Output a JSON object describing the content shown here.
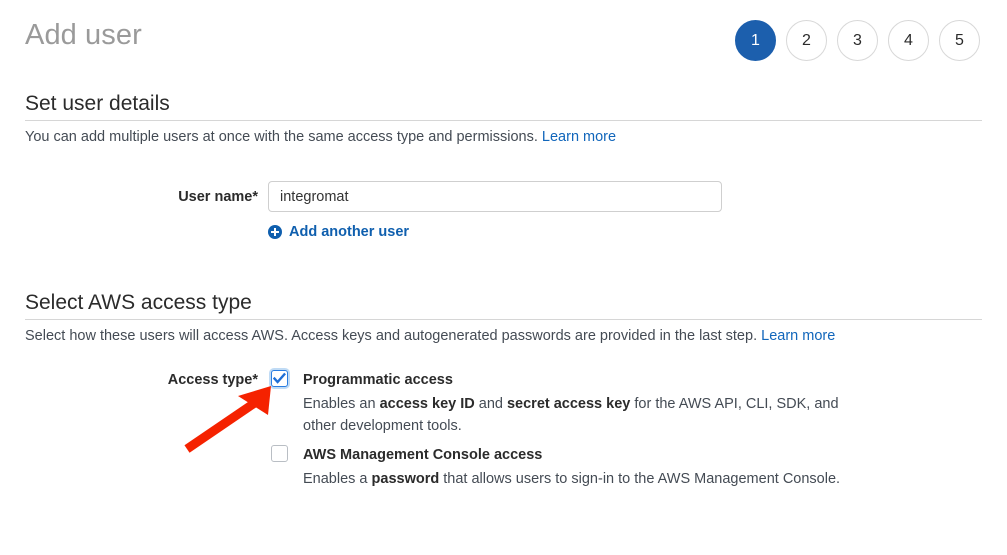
{
  "page": {
    "title": "Add user"
  },
  "wizard": {
    "steps": [
      {
        "label": "1",
        "state": "active"
      },
      {
        "label": "2",
        "state": "inactive"
      },
      {
        "label": "3",
        "state": "inactive"
      },
      {
        "label": "4",
        "state": "inactive"
      },
      {
        "label": "5",
        "state": "inactive"
      }
    ]
  },
  "user_details": {
    "heading": "Set user details",
    "description": "You can add multiple users at once with the same access type and permissions.",
    "learn_more": "Learn more",
    "username_label": "User name*",
    "username_value": "integromat",
    "username_placeholder": "",
    "add_another_user": "Add another user"
  },
  "access_type": {
    "heading": "Select AWS access type",
    "description": "Select how these users will access AWS. Access keys and autogenerated passwords are provided in the last step.",
    "learn_more": "Learn more",
    "label": "Access type*",
    "options": [
      {
        "title": "Programmatic access",
        "checked": true,
        "desc_part1": "Enables an ",
        "desc_bold1": "access key ID",
        "desc_part2": " and ",
        "desc_bold2": "secret access key",
        "desc_part3": " for the AWS API, CLI, SDK, and other development tools."
      },
      {
        "title": "AWS Management Console access",
        "checked": false,
        "desc_part1": "Enables a ",
        "desc_bold1": "password",
        "desc_part2": " that allows users to sign-in to the AWS Management Console.",
        "desc_bold2": "",
        "desc_part3": ""
      }
    ]
  },
  "annotation": {
    "arrow_color": "#f52200"
  },
  "colors": {
    "accent_blue": "#1c5fad",
    "link_blue": "#1166bb",
    "title_gray": "#9a9a9a"
  }
}
